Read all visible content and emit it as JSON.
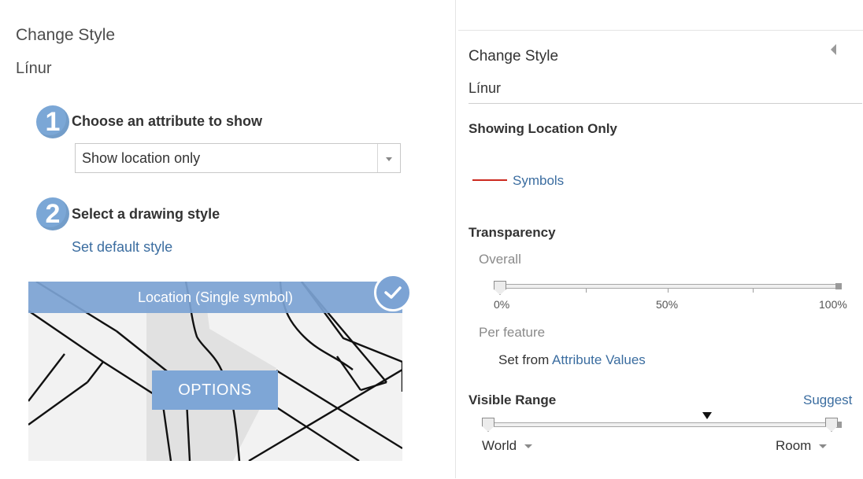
{
  "left": {
    "title": "Change Style",
    "layer_name": "Línur",
    "step1": {
      "number": "1",
      "label": "Choose an attribute to show",
      "select_value": "Show location only"
    },
    "step2": {
      "number": "2",
      "label": "Select a drawing style",
      "default_link": "Set default style"
    },
    "style_card": {
      "label": "Location (Single symbol)",
      "options_button": "OPTIONS",
      "selected": true
    }
  },
  "right": {
    "title": "Change Style",
    "layer_name": "Línur",
    "showing_heading": "Showing Location Only",
    "symbols_link": "Symbols",
    "symbol_color": "#cc2a1f",
    "transparency": {
      "heading": "Transparency",
      "overall_label": "Overall",
      "overall_value_percent": 0,
      "scale_labels": [
        "0%",
        "50%",
        "100%"
      ],
      "per_feature_label": "Per feature",
      "set_from_text": "Set from",
      "attribute_values_link": "Attribute Values"
    },
    "visible_range": {
      "heading": "Visible Range",
      "suggest_link": "Suggest",
      "min_label": "World",
      "max_label": "Room"
    }
  },
  "colors": {
    "accent": "#7ba7d6",
    "link": "#3b6da0"
  }
}
